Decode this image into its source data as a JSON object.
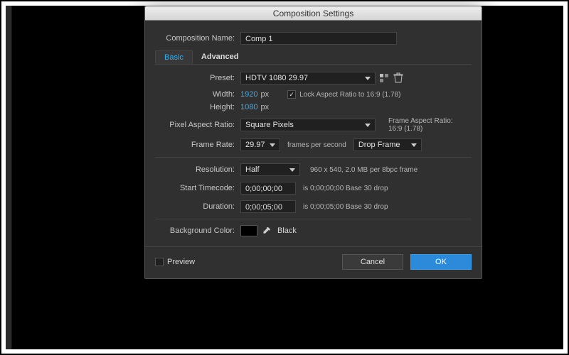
{
  "dialog": {
    "title": "Composition Settings",
    "name_label": "Composition Name:",
    "name_value": "Comp 1",
    "tabs": {
      "basic": "Basic",
      "advanced": "Advanced"
    },
    "preset_label": "Preset:",
    "preset_value": "HDTV 1080 29.97",
    "width_label": "Width:",
    "width_value": "1920",
    "height_label": "Height:",
    "height_value": "1080",
    "px_unit": "px",
    "lock_ar_label": "Lock Aspect Ratio to 16:9 (1.78)",
    "par_label": "Pixel Aspect Ratio:",
    "par_value": "Square Pixels",
    "frame_ar_label": "Frame Aspect Ratio:",
    "frame_ar_value": "16:9 (1.78)",
    "fps_label": "Frame Rate:",
    "fps_value": "29.97",
    "fps_unit": "frames per second",
    "drop_value": "Drop Frame",
    "resolution_label": "Resolution:",
    "resolution_value": "Half",
    "resolution_info": "960 x 540, 2.0 MB per 8bpc frame",
    "start_tc_label": "Start Timecode:",
    "start_tc_value": "0;00;00;00",
    "start_tc_info": "is 0;00;00;00 Base 30  drop",
    "duration_label": "Duration:",
    "duration_value": "0;00;05;00",
    "duration_info": "is 0;00;05;00  Base 30  drop",
    "bg_label": "Background Color:",
    "bg_name": "Black",
    "preview_label": "Preview",
    "cancel": "Cancel",
    "ok": "OK"
  }
}
